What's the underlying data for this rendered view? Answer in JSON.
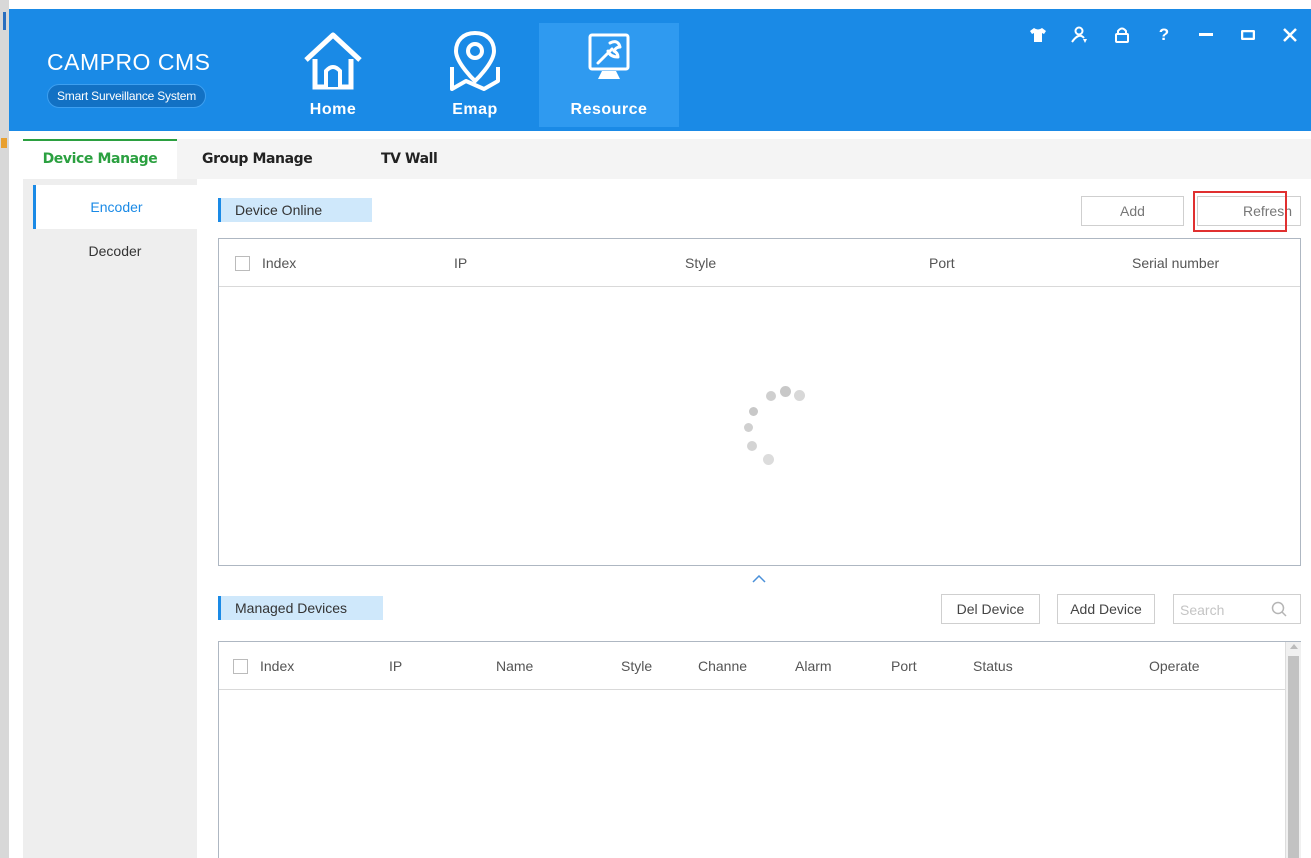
{
  "app": {
    "title": "CAMPRO CMS",
    "subtitle": "Smart Surveillance System",
    "accent_color": "#1a8ae6",
    "active_tab_color": "#2ba040"
  },
  "nav": [
    {
      "label": "Home",
      "icon": "home-icon"
    },
    {
      "label": "Emap",
      "icon": "map-pin-icon"
    },
    {
      "label": "Resource",
      "icon": "wrench-monitor-icon"
    }
  ],
  "window_controls": [
    {
      "icon": "skin-shirt-icon",
      "glyph": "👕"
    },
    {
      "icon": "user-switch-icon",
      "glyph": "⟳"
    },
    {
      "icon": "lock-icon",
      "glyph": "🔒"
    },
    {
      "icon": "help-icon",
      "glyph": "?"
    },
    {
      "icon": "minimize-icon",
      "glyph": "—"
    },
    {
      "icon": "maximize-icon",
      "glyph": "▭"
    },
    {
      "icon": "close-icon",
      "glyph": "✕"
    }
  ],
  "tabs": [
    {
      "label": "Device Manage",
      "active": true
    },
    {
      "label": "Group Manage",
      "active": false
    },
    {
      "label": "TV Wall",
      "active": false
    }
  ],
  "sidenav": [
    {
      "label": "Encoder",
      "active": true
    },
    {
      "label": "Decoder",
      "active": false
    }
  ],
  "online": {
    "title": "Device Online",
    "add_label": "Add",
    "refresh_label": "Refresh",
    "columns": [
      "Index",
      "IP",
      "Style",
      "Port",
      "Serial number"
    ],
    "rows": [],
    "loading": true
  },
  "managed": {
    "title": "Managed Devices",
    "del_label": "Del Device",
    "add_label": "Add Device",
    "search_placeholder": "Search",
    "columns": [
      "Index",
      "IP",
      "Name",
      "Style",
      "Channe",
      "Alarm",
      "Port",
      "Status",
      "Operate"
    ],
    "rows": []
  }
}
